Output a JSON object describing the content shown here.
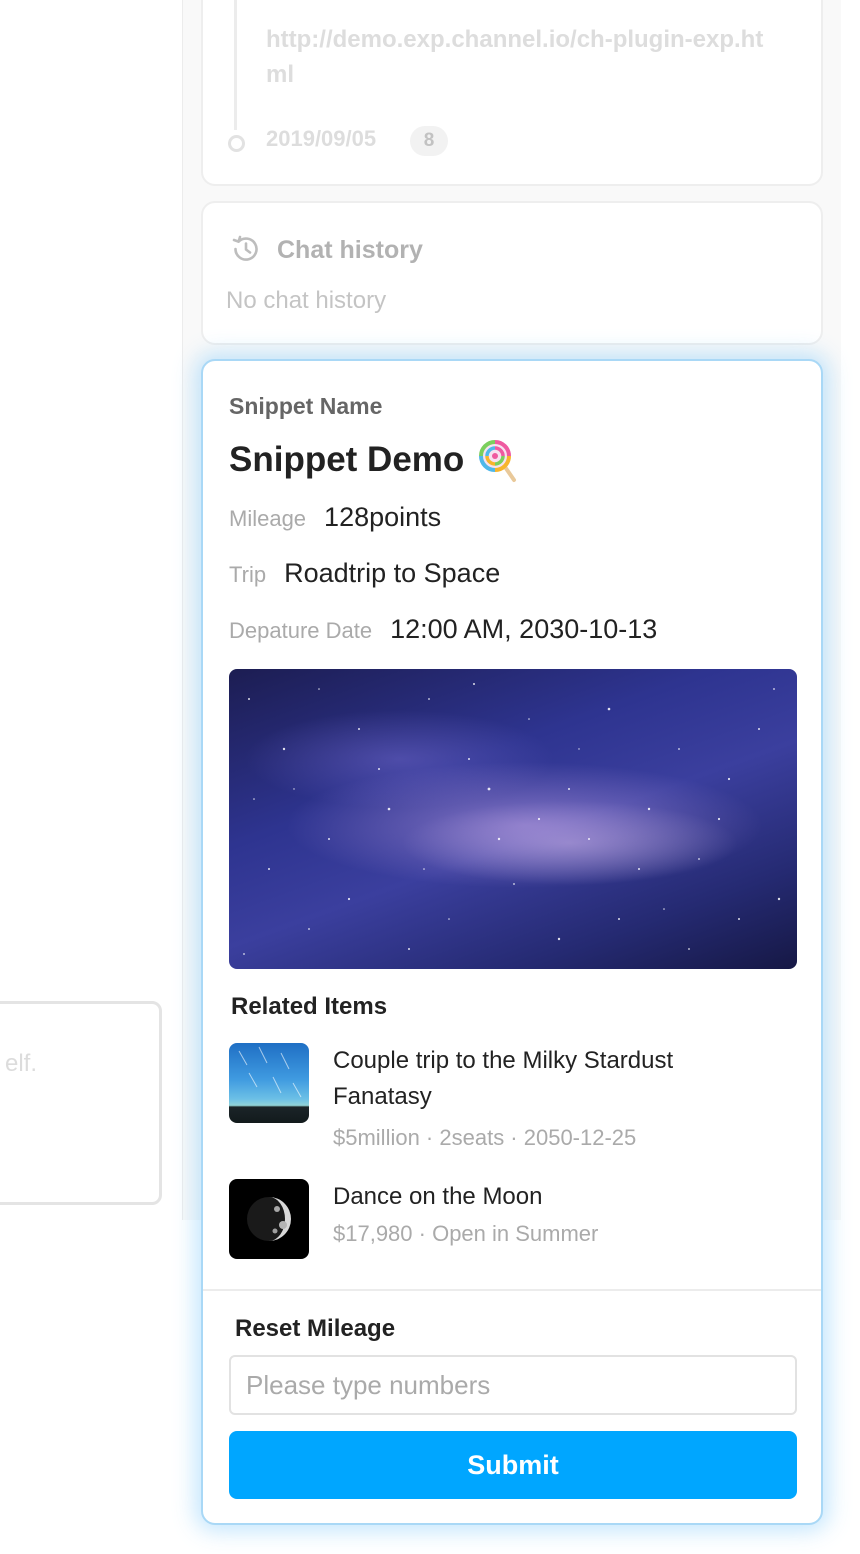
{
  "background_card": {
    "faded_text": "elf."
  },
  "visit": {
    "url": "http://demo.exp.channel.io/ch-plugin-exp.html",
    "date": "2019/09/05",
    "count": "8"
  },
  "chat_history": {
    "title": "Chat history",
    "empty_text": "No chat history",
    "icon": "history-icon"
  },
  "snippet": {
    "label": "Snippet Name",
    "title": "Snippet Demo",
    "title_icon": "lollipop-icon",
    "fields": [
      {
        "key": "Mileage",
        "value": "128points"
      },
      {
        "key": "Trip",
        "value": "Roadtrip to Space"
      },
      {
        "key": "Depature Date",
        "value": "12:00 AM, 2030-10-13"
      }
    ],
    "image": "milky-way-image",
    "related_title": "Related Items",
    "related_items": [
      {
        "name": "Couple trip to the Milky Stardust Fanatasy",
        "meta": "$5million · 2seats · 2050-12-25",
        "thumb": "milky-stardust-thumb"
      },
      {
        "name": "Dance on the Moon",
        "meta": "$17,980 · Open in Summer",
        "thumb": "moon-thumb"
      }
    ],
    "reset": {
      "title": "Reset Mileage",
      "placeholder": "Please type numbers",
      "value": "",
      "submit_label": "Submit"
    }
  },
  "colors": {
    "accent": "#00a6ff",
    "card_glow": "#a9d8f6",
    "muted_text": "#aaaaaa",
    "primary_text": "#222222"
  }
}
